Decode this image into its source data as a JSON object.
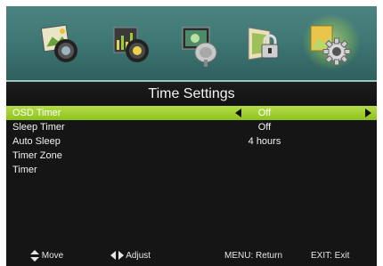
{
  "categories": [
    {
      "name": "picture",
      "icon": "picture-icon"
    },
    {
      "name": "sound",
      "icon": "sound-icon"
    },
    {
      "name": "channel",
      "icon": "channel-icon"
    },
    {
      "name": "lock",
      "icon": "lock-icon"
    },
    {
      "name": "setup",
      "icon": "setup-gear-icon",
      "active": true
    }
  ],
  "title": "Time Settings",
  "menu": [
    {
      "label": "OSD Timer",
      "value": "Off",
      "selected": true
    },
    {
      "label": "Sleep Timer",
      "value": "Off"
    },
    {
      "label": "Auto Sleep",
      "value": "4 hours"
    },
    {
      "label": "Timer Zone",
      "value": ""
    },
    {
      "label": "Timer",
      "value": ""
    }
  ],
  "status": {
    "move": "Move",
    "adjust": "Adjust",
    "menu_return": "MENU: Return",
    "exit": "EXIT: Exit"
  },
  "colors": {
    "selected_row": "#9fd02a",
    "icon_bar": "#3f7875",
    "background": "#151515"
  }
}
